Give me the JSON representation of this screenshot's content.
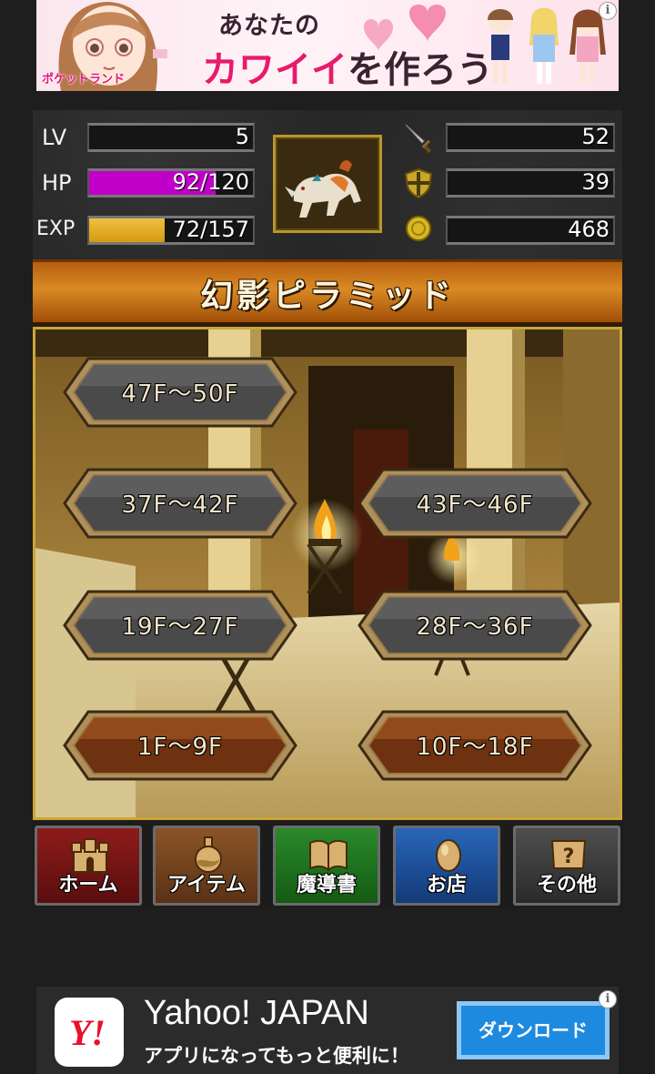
{
  "ad_top": {
    "brand": "ポケットランド",
    "line1": "あなたの",
    "line2_pink": "カワイイ",
    "line2_rest": "を作ろう",
    "info": "i"
  },
  "status": {
    "lv": {
      "label": "LV",
      "value": "5"
    },
    "hp": {
      "label": "HP",
      "value": "92/120",
      "fraction": 0.77
    },
    "exp": {
      "label": "EXP",
      "value": "72/157",
      "fraction": 0.46
    },
    "attack": {
      "icon": "sword-icon",
      "value": "52"
    },
    "defense": {
      "icon": "shield-icon",
      "value": "39"
    },
    "gold": {
      "icon": "coin-icon",
      "value": "468"
    }
  },
  "dungeon_title": "幻影ピラミッド",
  "floors": [
    {
      "label": "47F～50F",
      "state": "normal"
    },
    {
      "label": "37F～42F",
      "state": "normal"
    },
    {
      "label": "43F～46F",
      "state": "normal"
    },
    {
      "label": "19F～27F",
      "state": "normal"
    },
    {
      "label": "28F～36F",
      "state": "normal"
    },
    {
      "label": "1F～9F",
      "state": "cleared"
    },
    {
      "label": "10F～18F",
      "state": "cleared"
    }
  ],
  "menu": [
    {
      "label": "ホーム",
      "icon": "castle-icon",
      "color": "#7a1414"
    },
    {
      "label": "アイテム",
      "icon": "potion-icon",
      "color": "#6b3d1a"
    },
    {
      "label": "魔導書",
      "icon": "book-icon",
      "color": "#1b6b1b"
    },
    {
      "label": "お店",
      "icon": "egg-icon",
      "color": "#1b4f9a"
    },
    {
      "label": "その他",
      "icon": "scroll-icon",
      "color": "#3a3a3a"
    }
  ],
  "ad_bottom": {
    "title": "Yahoo! JAPAN",
    "subtitle": "アプリになってもっと便利に！",
    "button": "ダウンロード",
    "info": "i"
  },
  "colors": {
    "hp_fill": "#c000c8",
    "exp_fill": "#d49a10",
    "panel_gold": "#caa636"
  }
}
